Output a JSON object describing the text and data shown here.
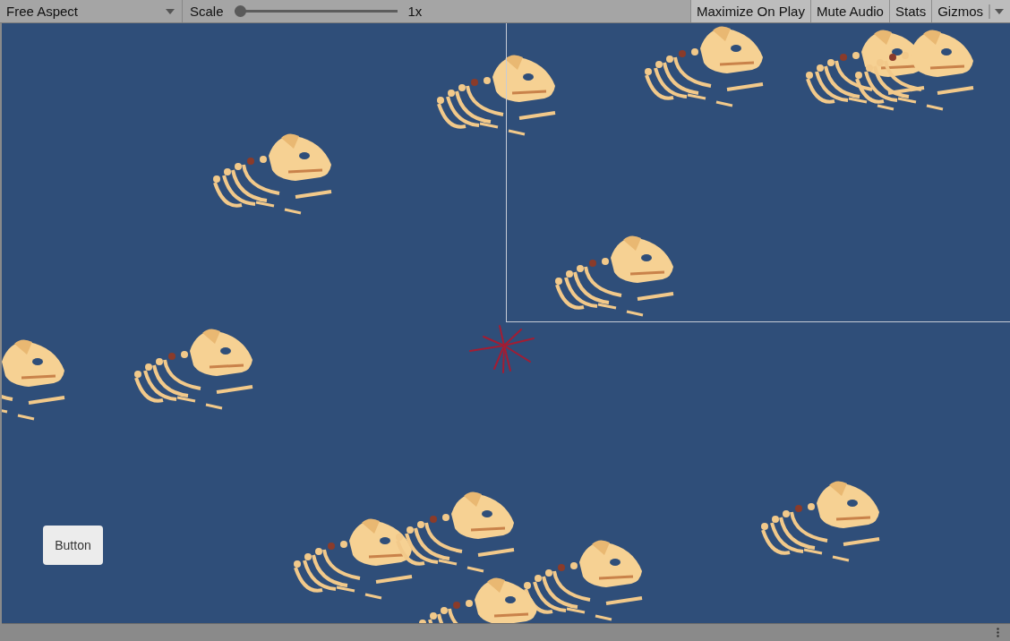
{
  "toolbar": {
    "aspect": "Free Aspect",
    "scale": {
      "label": "Scale",
      "level": 0,
      "reading": "1x"
    },
    "buttons": [
      {
        "label": "Maximize On Play"
      },
      {
        "label": "Mute Audio"
      },
      {
        "label": "Stats"
      },
      {
        "label": "Gizmos",
        "kind": "dropdown"
      }
    ]
  },
  "game_view": {
    "button": "Button"
  }
}
